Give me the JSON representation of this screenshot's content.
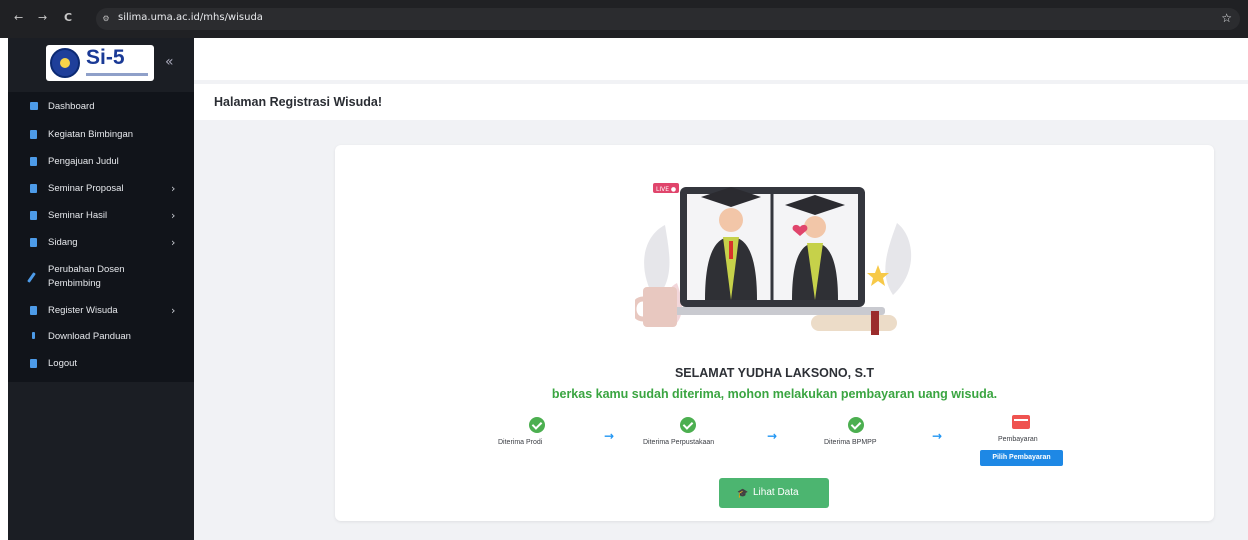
{
  "browser": {
    "url": "silima.uma.ac.id/mhs/wisuda",
    "back_icon": "←",
    "forward_icon": "→",
    "reload_icon": "C",
    "site_icon": "⚙",
    "star_icon": "☆"
  },
  "sidebar": {
    "logo_text": "Si-5",
    "collapse_icon": "«",
    "items": [
      {
        "label": "Dashboard",
        "arrow": ""
      },
      {
        "label": "Kegiatan Bimbingan",
        "arrow": ""
      },
      {
        "label": "Pengajuan Judul",
        "arrow": ""
      },
      {
        "label": "Seminar Proposal",
        "arrow": "›"
      },
      {
        "label": "Seminar Hasil",
        "arrow": "›"
      },
      {
        "label": "Sidang",
        "arrow": "›"
      },
      {
        "label": "Perubahan Dosen",
        "label2": "Pembimbing",
        "arrow": ""
      },
      {
        "label": "Register Wisuda",
        "arrow": "›"
      },
      {
        "label": "Download Panduan",
        "arrow": ""
      },
      {
        "label": "Logout",
        "arrow": ""
      }
    ]
  },
  "main": {
    "page_title": "Halaman Registrasi Wisuda!",
    "congrats": "SELAMAT YUDHA LAKSONO, S.T",
    "status_message": "berkas kamu sudah diterima, mohon melakukan pembayaran uang wisuda.",
    "illustration_badge": "LIVE ●",
    "steps": [
      {
        "label": "Diterima Prodi"
      },
      {
        "label": "Diterima Perpustakaan"
      },
      {
        "label": "Diterima BPMPP"
      },
      {
        "label": "Pembayaran"
      }
    ],
    "arrow_icon": "→",
    "pay_button": "Pilih Pembayaran",
    "view_button": "Lihat Data",
    "view_button_icon": "🎓"
  },
  "colors": {
    "sidebar_bg": "#11141a",
    "accent_green": "#3aa541",
    "accent_blue": "#1e88e5",
    "button_green": "#4cb570"
  }
}
